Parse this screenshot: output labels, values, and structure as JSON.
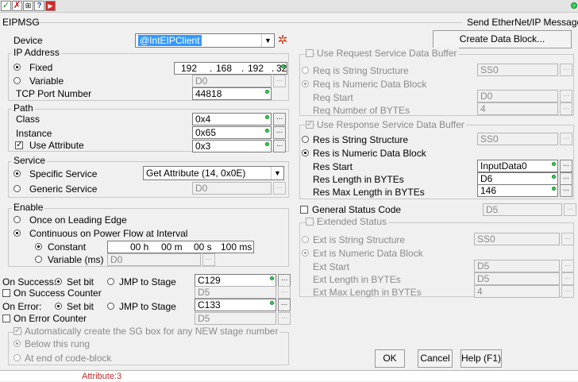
{
  "toolbar": {
    "icons": [
      "check-icon",
      "x-icon",
      "split-icon",
      "help-icon",
      "close-icon"
    ]
  },
  "title_bar": {
    "left": "EIPMSG",
    "right": "Send EtherNet/IP Message"
  },
  "device": {
    "label": "Device",
    "value": "@IntEIPClient"
  },
  "create_data_block": "Create Data Block...",
  "ip": {
    "group": "IP Address",
    "fixed": "Fixed",
    "ip_parts": [
      "192",
      "168",
      "192",
      "32"
    ],
    "variable": "Variable",
    "variable_value": "D0",
    "tcp_label": "TCP Port Number",
    "tcp_value": "44818"
  },
  "path": {
    "group": "Path",
    "class_label": "Class",
    "class_value": "0x4",
    "instance_label": "Instance",
    "instance_value": "0x65",
    "attr_label": "Use Attribute",
    "attr_value": "0x3"
  },
  "service": {
    "group": "Service",
    "specific": "Specific Service",
    "specific_value": "Get Attribute (14, 0x0E)",
    "generic": "Generic Service",
    "generic_value": "D0"
  },
  "enable": {
    "group": "Enable",
    "once": "Once on Leading Edge",
    "continuous": "Continuous on Power Flow at Interval",
    "constant": "Constant",
    "h_val": "00 h",
    "m_val": "00 m",
    "s_val": "00 s",
    "ms_val": "100 ms",
    "variable": "Variable (ms)",
    "variable_value": "D0"
  },
  "success": {
    "label": "On Success:",
    "setbit": "Set bit",
    "jmp": "JMP to Stage",
    "value": "C129",
    "counter": "On Success Counter",
    "counter_value": "D5"
  },
  "error": {
    "label": "On Error:",
    "setbit": "Set bit",
    "jmp": "JMP to Stage",
    "value": "C133",
    "counter": "On Error Counter",
    "counter_value": "D5"
  },
  "auto_sg": {
    "label": "Automatically create the SG box for any NEW stage number",
    "below": "Below this rung",
    "end": "At end of code-block"
  },
  "req": {
    "group": "Use Request Service Data Buffer",
    "string": "Req is String Structure",
    "string_value": "SS0",
    "numeric": "Req is Numeric Data Block",
    "start_label": "Req Start",
    "start_value": "D0",
    "num_label": "Req Number of BYTEs",
    "num_value": "4"
  },
  "res": {
    "group": "Use Response Service Data Buffer",
    "string": "Res is String Structure",
    "string_value": "SS0",
    "numeric": "Res is Numeric Data Block",
    "start_label": "Res Start",
    "start_value": "InputData0",
    "len_label": "Res Length in BYTEs",
    "len_value": "D6",
    "max_label": "Res Max Length in BYTEs",
    "max_value": "146"
  },
  "gsc": {
    "label": "General Status Code",
    "value": "D5"
  },
  "ext": {
    "group": "Extended Status",
    "string": "Ext is String Structure",
    "string_value": "SS0",
    "numeric": "Ext is Numeric Data Block",
    "start_label": "Ext Start",
    "start_value": "D5",
    "len_label": "Ext Length in BYTEs",
    "len_value": "D5",
    "max_label": "Ext Max Length in BYTEs",
    "max_value": "4"
  },
  "buttons": {
    "ok": "OK",
    "cancel": "Cancel",
    "help": "Help (F1)"
  },
  "background_text": "Attribute:3",
  "colors": {
    "required_dot": "#39d353",
    "selection": "#3399ff"
  }
}
